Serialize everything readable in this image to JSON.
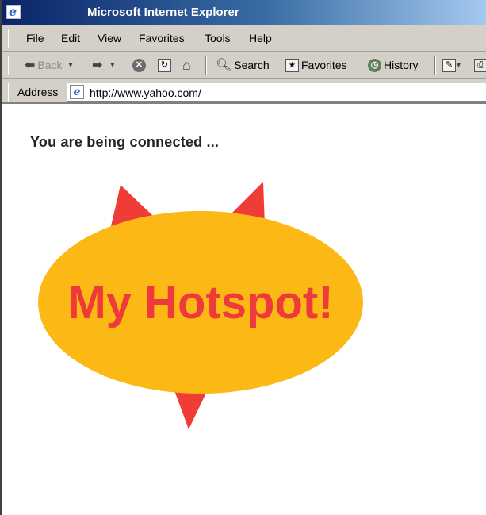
{
  "window": {
    "title": "Microsoft Internet Explorer"
  },
  "menu": {
    "items": [
      {
        "label": "File"
      },
      {
        "label": "Edit"
      },
      {
        "label": "View"
      },
      {
        "label": "Favorites"
      },
      {
        "label": "Tools"
      },
      {
        "label": "Help"
      }
    ]
  },
  "toolbar": {
    "back_label": "Back",
    "search_label": "Search",
    "favorites_label": "Favorites",
    "history_label": "History"
  },
  "address": {
    "label": "Address",
    "url": "http://www.yahoo.com/"
  },
  "page": {
    "connecting_text": "You are being connected ...",
    "logo_text": "My Hotspot!"
  },
  "colors": {
    "logo_ellipse": "#fcb814",
    "logo_horns": "#ef3c36",
    "logo_text": "#ee3a3a"
  },
  "icons": [
    "ie-icon",
    "back-arrow-icon",
    "forward-arrow-icon",
    "stop-icon",
    "refresh-icon",
    "home-icon",
    "search-icon",
    "favorites-icon",
    "history-icon",
    "edit-icon",
    "print-icon",
    "page-icon"
  ]
}
